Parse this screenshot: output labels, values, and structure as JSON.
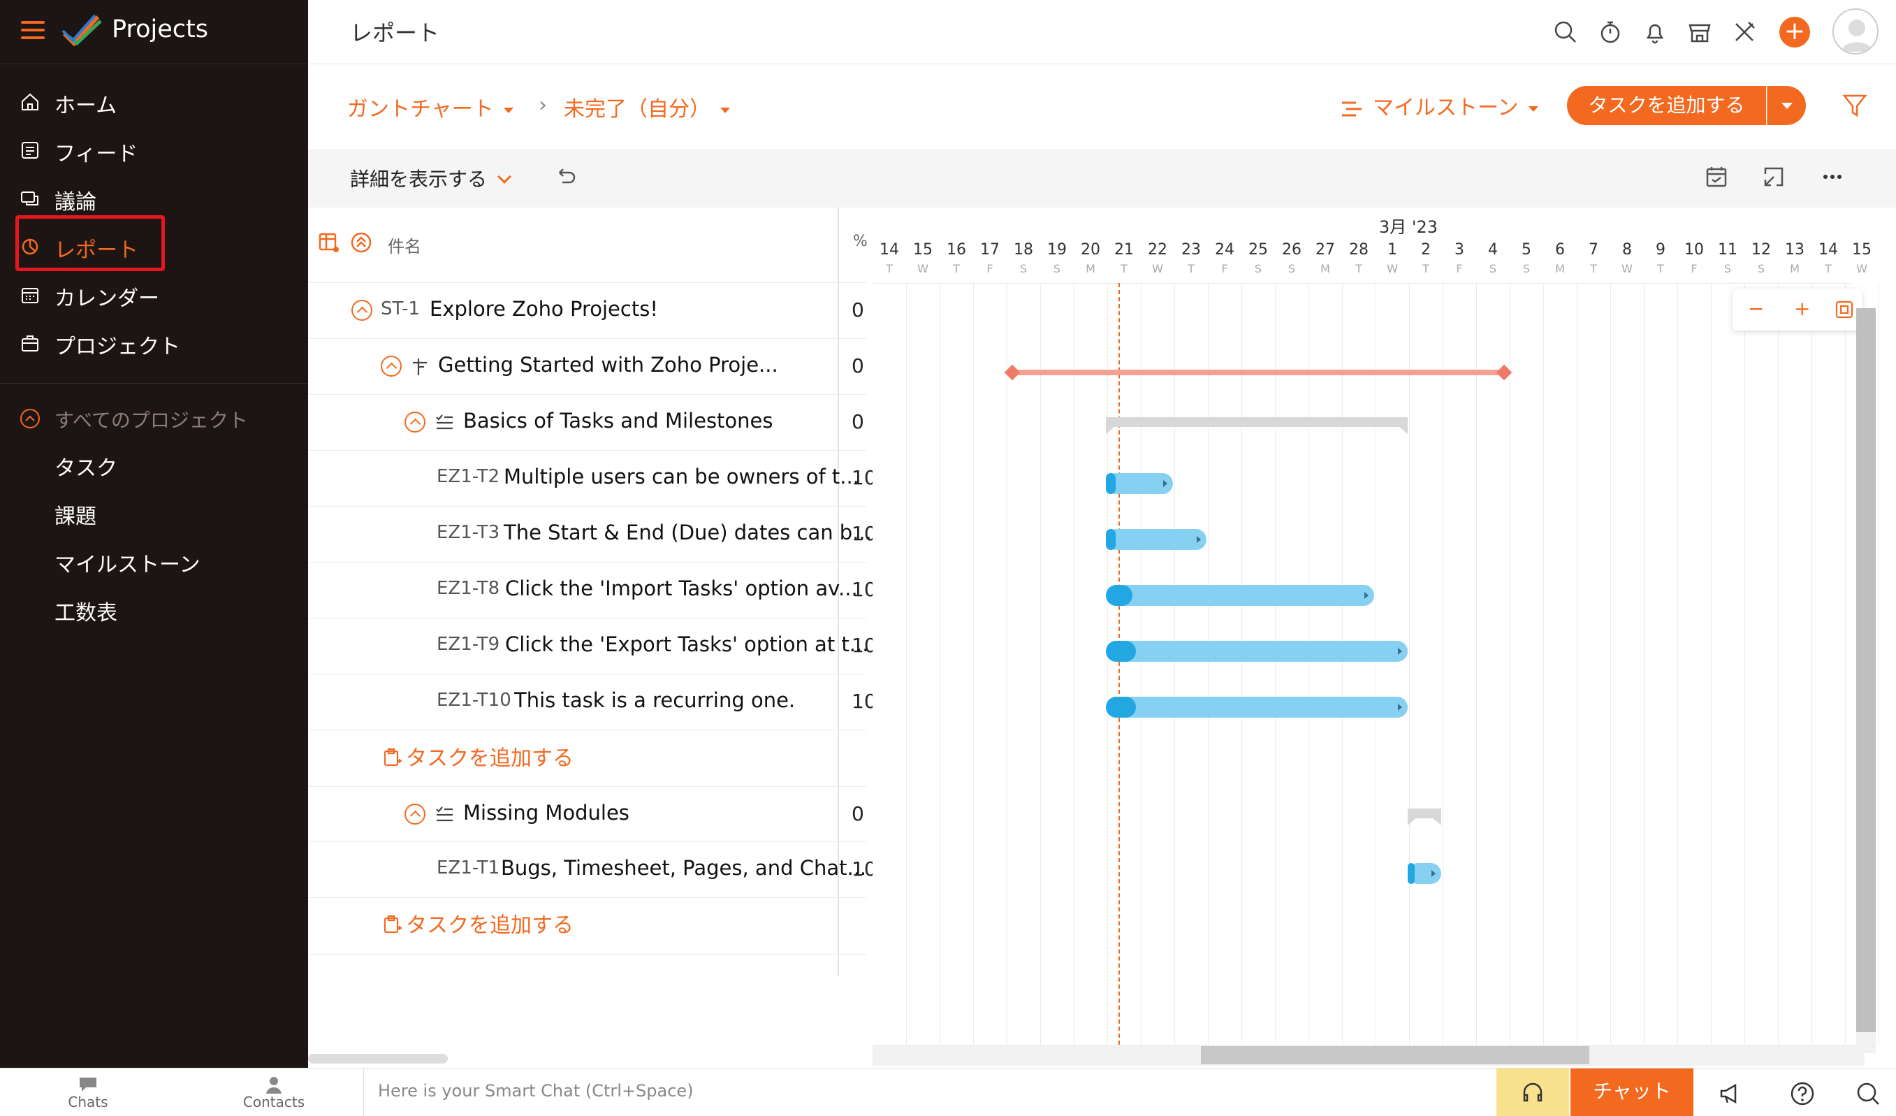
{
  "sidebar": {
    "brand": "Projects",
    "nav": [
      {
        "label": "ホーム",
        "icon": "home-icon"
      },
      {
        "label": "フィード",
        "icon": "feed-icon"
      },
      {
        "label": "議論",
        "icon": "discussion-icon"
      },
      {
        "label": "レポート",
        "icon": "report-icon",
        "active": true
      },
      {
        "label": "カレンダー",
        "icon": "calendar-icon"
      },
      {
        "label": "プロジェクト",
        "icon": "project-icon"
      }
    ],
    "projects_heading": "すべてのプロジェクト",
    "sub_items": [
      "タスク",
      "課題",
      "マイルストーン",
      "工数表"
    ]
  },
  "header": {
    "title": "レポート",
    "icons": [
      "search-icon",
      "timer-icon",
      "bell-icon",
      "store-icon",
      "tools-icon",
      "plus-icon",
      "avatar"
    ]
  },
  "toolbar": {
    "view": "ガントチャート",
    "filter_view": "未完了（自分）",
    "milestone": "マイルストーン",
    "add_task": "タスクを追加する"
  },
  "toolbar2": {
    "details": "詳細を表示する"
  },
  "table": {
    "col_name": "件名",
    "col_pct": "%",
    "rows": [
      {
        "id": "ST-1",
        "name": "Explore Zoho Projects!",
        "pct": "0"
      },
      {
        "id": "",
        "name": "Getting Started with Zoho Proje...",
        "pct": "0"
      },
      {
        "id": "",
        "name": "Basics of Tasks and Milestones",
        "pct": "0"
      },
      {
        "id": "EZ1-T2",
        "name": "Multiple users can be owners of t...",
        "pct": "10"
      },
      {
        "id": "EZ1-T3",
        "name": "The Start & End (Due) dates can b...",
        "pct": "10"
      },
      {
        "id": "EZ1-T8",
        "name": "Click the 'Import Tasks' option av...",
        "pct": "10"
      },
      {
        "id": "EZ1-T9",
        "name": "Click the 'Export Tasks' option at t...",
        "pct": "10"
      },
      {
        "id": "EZ1-T10",
        "name": "This task is a recurring one.",
        "pct": "10"
      },
      {
        "id": "",
        "name": "Missing Modules",
        "pct": "0"
      },
      {
        "id": "EZ1-T1",
        "name": "Bugs, Timesheet, Pages, and Chat...",
        "pct": "10"
      }
    ],
    "add_task_label": "タスクを追加する"
  },
  "gantt": {
    "month_label": "3月 '23",
    "days": [
      "14",
      "15",
      "16",
      "17",
      "18",
      "19",
      "20",
      "21",
      "22",
      "23",
      "24",
      "25",
      "26",
      "27",
      "28",
      "1",
      "2",
      "3",
      "4",
      "5",
      "6",
      "7",
      "8",
      "9",
      "10",
      "11",
      "12",
      "13",
      "14",
      "15"
    ],
    "weekdays": [
      "T",
      "W",
      "T",
      "F",
      "S",
      "S",
      "M",
      "T",
      "W",
      "T",
      "F",
      "S",
      "S",
      "M",
      "T",
      "W",
      "T",
      "F",
      "S",
      "S",
      "M",
      "T",
      "W",
      "T",
      "F",
      "S",
      "S",
      "M",
      "T",
      "W"
    ],
    "zoom_minus": "−",
    "zoom_plus": "+"
  },
  "bottombar": {
    "chats": "Chats",
    "contacts": "Contacts",
    "smartchat_placeholder": "Here is your Smart Chat (Ctrl+Space)",
    "chat_button": "チャット"
  },
  "colors": {
    "accent": "#f3691f",
    "sidebar_bg": "#1d1513",
    "bar": "#86d1f2",
    "bar_progress": "#22a7e2",
    "highlight": "#e5161e"
  }
}
